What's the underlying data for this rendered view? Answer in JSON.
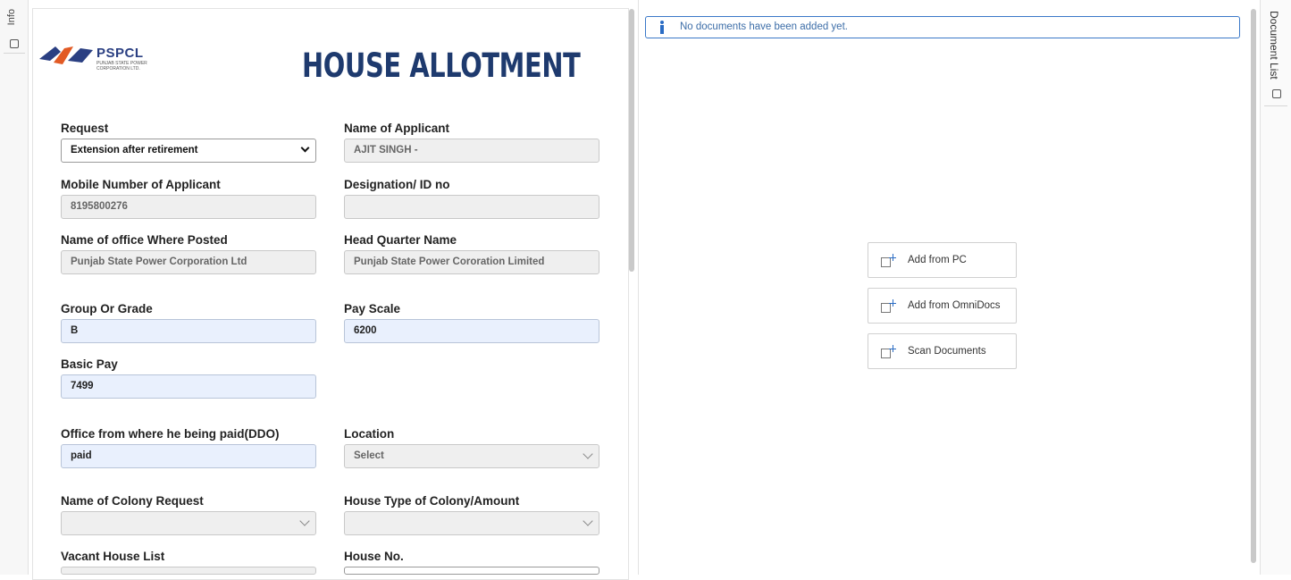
{
  "left_tab": {
    "label": "Info"
  },
  "right_tab": {
    "label": "Document List"
  },
  "logo": {
    "text": "PSPCL",
    "subtext": "PUNJAB STATE POWER CORPORATION LTD."
  },
  "form": {
    "title": "HOUSE ALLOTMENT",
    "request": {
      "label": "Request",
      "value": "Extension after retirement"
    },
    "applicant_name": {
      "label": "Name of Applicant",
      "value": "AJIT SINGH -"
    },
    "mobile": {
      "label": "Mobile Number of Applicant",
      "value": "8195800276"
    },
    "designation": {
      "label": "Designation/ ID no",
      "value": ""
    },
    "office_posted": {
      "label": "Name of office Where Posted",
      "value": "Punjab State Power Corporation Ltd"
    },
    "head_quarter": {
      "label": "Head Quarter Name",
      "value": "Punjab State Power Cororation Limited"
    },
    "group_grade": {
      "label": "Group Or Grade",
      "value": "B"
    },
    "pay_scale": {
      "label": "Pay Scale",
      "value": "6200"
    },
    "basic_pay": {
      "label": "Basic Pay",
      "value": "7499"
    },
    "ddo_office": {
      "label": "Office from where he being paid(DDO)",
      "value": "paid"
    },
    "location": {
      "label": "Location",
      "value": "Select"
    },
    "colony_request": {
      "label": "Name of Colony Request",
      "value": ""
    },
    "house_type": {
      "label": "House Type of Colony/Amount",
      "value": ""
    },
    "vacant_house": {
      "label": "Vacant House List",
      "value": ""
    },
    "house_no": {
      "label": "House No.",
      "value": ""
    }
  },
  "documents": {
    "notice": "No documents have been added yet.",
    "add_from_pc": "Add from PC",
    "add_from_omnidocs": "Add from OmniDocs",
    "scan_documents": "Scan Documents"
  },
  "colors": {
    "title": "#1e3a6e",
    "accent": "#2a6cc4",
    "editable_bg": "#e9f0fd"
  }
}
